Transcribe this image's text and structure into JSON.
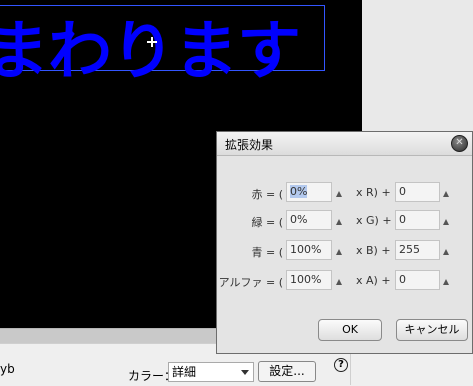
{
  "stage": {
    "text": "まわります"
  },
  "bottom_bar": {
    "property_name": "yb",
    "color_label": "カラー：",
    "color_value": "詳細",
    "settings_button": "設定...",
    "help_icon": "?"
  },
  "dialog": {
    "title": "拡張効果",
    "rows": [
      {
        "label": "赤 = (",
        "percent": "0%",
        "op": "x R) +",
        "offset": "0"
      },
      {
        "label": "緑 = (",
        "percent": "0%",
        "op": "x G) +",
        "offset": "0"
      },
      {
        "label": "青 = (",
        "percent": "100%",
        "op": "x B) +",
        "offset": "255"
      },
      {
        "label": "アルファ = (",
        "percent": "100%",
        "op": "x A) +",
        "offset": "0"
      }
    ],
    "ok_label": "OK",
    "cancel_label": "キャンセル"
  }
}
